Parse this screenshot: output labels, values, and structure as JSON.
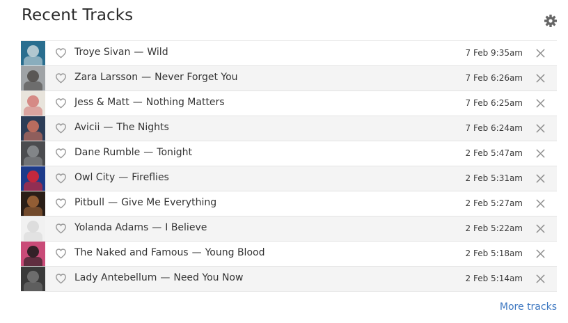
{
  "widget": {
    "title": "Recent Tracks",
    "settings_icon": "gear-icon",
    "more_link": "More tracks",
    "link_color": "#3b76c0"
  },
  "tracks": [
    {
      "artist": "Troye Sivan",
      "title": "Wild",
      "separator": "—",
      "time": "7 Feb 9:35am",
      "art": [
        "#2a6e8f",
        "#c9d7dc"
      ]
    },
    {
      "artist": "Zara Larsson",
      "title": "Never Forget You",
      "separator": "—",
      "time": "7 Feb 6:26am",
      "art": [
        "#9fa3a6",
        "#4d4a47"
      ]
    },
    {
      "artist": "Jess & Matt",
      "title": "Nothing Matters",
      "separator": "—",
      "time": "7 Feb 6:25am",
      "art": [
        "#e8e4dc",
        "#d27a76"
      ]
    },
    {
      "artist": "Avicii",
      "title": "The Nights",
      "separator": "—",
      "time": "7 Feb 6:24am",
      "art": [
        "#2c3d57",
        "#d2745f"
      ]
    },
    {
      "artist": "Dane Rumble",
      "title": "Tonight",
      "separator": "—",
      "time": "2 Feb 5:47am",
      "art": [
        "#4b4c4f",
        "#8c8f92"
      ]
    },
    {
      "artist": "Owl City",
      "title": "Fireflies",
      "separator": "—",
      "time": "2 Feb 5:31am",
      "art": [
        "#1d3b8a",
        "#e0262f"
      ]
    },
    {
      "artist": "Pitbull",
      "title": "Give Me Everything",
      "separator": "—",
      "time": "2 Feb 5:27am",
      "art": [
        "#2a1e17",
        "#a4683a"
      ]
    },
    {
      "artist": "Yolanda Adams",
      "title": "I Believe",
      "separator": "—",
      "time": "2 Feb 5:22am",
      "art": [
        "#f1f1f1",
        "#d9d9d9"
      ]
    },
    {
      "artist": "The Naked and Famous",
      "title": "Young Blood",
      "separator": "—",
      "time": "2 Feb 5:18am",
      "art": [
        "#c94b78",
        "#1a1a1a"
      ]
    },
    {
      "artist": "Lady Antebellum",
      "title": "Need You Now",
      "separator": "—",
      "time": "2 Feb 5:14am",
      "art": [
        "#3a3a3a",
        "#777777"
      ]
    }
  ]
}
